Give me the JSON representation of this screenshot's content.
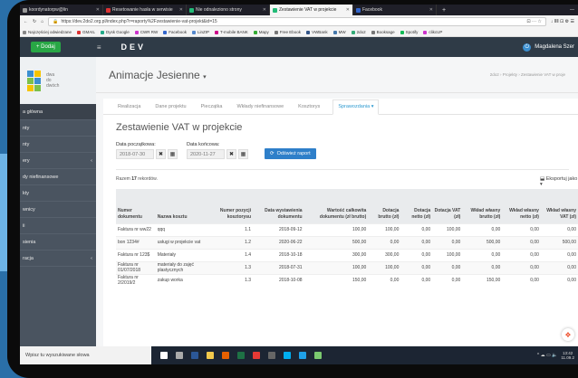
{
  "browser": {
    "tabs": [
      {
        "label": "koordynatorpw@lin",
        "color": "#999"
      },
      {
        "label": "Resetowanie hasła w serwisie",
        "color": "#d33"
      },
      {
        "label": "Nie odnaleziono strony",
        "color": "#2b7"
      },
      {
        "label": "Zestawienie VAT w projekcie",
        "color": "#2b7"
      },
      {
        "label": "Facebook",
        "color": "#36c"
      }
    ],
    "new_tab": "+",
    "window_controls": "—",
    "url": "https://dev.2do2.org.pl/index.php?r=raporty%2Fzestawienie-vat-projekt&id=15",
    "url_actions": "⊡ ··· ☆",
    "toolbar_right": "↓ ⅡⅡ ⊡ ⚙ ☰",
    "bookmarks": [
      {
        "label": "Najczęściej odwiedzane",
        "color": "#888"
      },
      {
        "label": "GMAIL",
        "color": "#d33"
      },
      {
        "label": "Dysk Google",
        "color": "#2a8"
      },
      {
        "label": "CWR RW",
        "color": "#c3c"
      },
      {
        "label": "Facebook",
        "color": "#36c"
      },
      {
        "label": "LinZIP",
        "color": "#58c"
      },
      {
        "label": "T-mobile BANK",
        "color": "#c08"
      },
      {
        "label": "Mapy",
        "color": "#3a3"
      },
      {
        "label": "Free Ebook",
        "color": "#777"
      },
      {
        "label": "VWBank",
        "color": "#358"
      },
      {
        "label": "MW",
        "color": "#47a"
      },
      {
        "label": "2do2",
        "color": "#3a7"
      },
      {
        "label": "Booksage",
        "color": "#777"
      },
      {
        "label": "Spotify",
        "color": "#1b5"
      },
      {
        "label": "clikcUP",
        "color": "#c3c"
      }
    ]
  },
  "topnav": {
    "add_label": "+ Dodaj",
    "menu_icon": "≡",
    "app_title": "DEV",
    "user_name": "Magdalena Szer",
    "power_icon": "⏻"
  },
  "sidebar": {
    "logo_text": [
      "dwa",
      "do",
      "dwóch"
    ],
    "items": [
      {
        "label": "a główna",
        "arrow": ""
      },
      {
        "label": "nty",
        "arrow": ""
      },
      {
        "label": "nty",
        "arrow": ""
      },
      {
        "label": "ery",
        "arrow": "‹"
      },
      {
        "label": "dy niefinansowe",
        "arrow": ""
      },
      {
        "label": "kty",
        "arrow": ""
      },
      {
        "label": "wnicy",
        "arrow": ""
      },
      {
        "label": "ii",
        "arrow": ""
      },
      {
        "label": "sienia",
        "arrow": ""
      },
      {
        "label": "racja",
        "arrow": "‹"
      }
    ]
  },
  "page": {
    "title": "Animacje Jesienne",
    "title_caret": "▾",
    "breadcrumb": "2do2 › Projekty › Zestawienie VAT w proje",
    "tabs": [
      "Realizacja",
      "Dane projektu",
      "Pieczątka",
      "Wkłady niefinansowe",
      "Kosztorys",
      "Sprawozdania ▾"
    ],
    "heading": "Zestawienie VAT w projekcie",
    "start_label": "Data początkowa:",
    "start_value": "2018-07-30",
    "end_label": "Data końcowa:",
    "end_value": "2020-11-27",
    "clear_icon": "✖",
    "calendar_icon": "▦",
    "refresh_icon": "⟳",
    "refresh_label": "Odśwież raport",
    "count_prefix": "Razem",
    "count": "17",
    "count_suffix": "rekordów.",
    "export_label": "Eksportuj jako ▾",
    "export_icon": "⬓"
  },
  "table": {
    "headers": [
      "Numer dokumentu",
      "Nazwa kosztu",
      "Numer pozycji kosztorysu",
      "Data wystawienia dokumentu",
      "Wartość całkowita dokumentu (zł brutto)",
      "Dotacja brutto (zł)",
      "Dotacja netto (zł)",
      "Dotacja VAT (zł)",
      "Wkład własny brutto (zł)",
      "Wkład własny netto (zł)",
      "Wkład własny VAT (zł)"
    ],
    "rows": [
      [
        "Faktura nr ww22",
        "qqq",
        "1.1",
        "2018-09-12",
        "100,00",
        "100,00",
        "0,00",
        "100,00",
        "0,00",
        "0,00",
        "0,00"
      ],
      [
        "bon 1234#",
        "usługi w projekcie vat",
        "1.2",
        "2020-06-22",
        "500,00",
        "0,00",
        "0,00",
        "0,00",
        "500,00",
        "0,00",
        "500,00"
      ],
      [
        "Faktura nr 123$",
        "Materiały",
        "1.4",
        "2018-10-18",
        "300,00",
        "300,00",
        "0,00",
        "100,00",
        "0,00",
        "0,00",
        "0,00"
      ],
      [
        "Faktura nr 01/07/2018",
        "materiały do zajęć plastycznych",
        "1.3",
        "2018-07-31",
        "100,00",
        "100,00",
        "0,00",
        "0,00",
        "0,00",
        "0,00",
        "0,00"
      ],
      [
        "Faktura nr 2/2019/2",
        "zakup worka",
        "1.3",
        "2018-10-08",
        "150,00",
        "0,00",
        "0,00",
        "0,00",
        "150,00",
        "0,00",
        "0,00"
      ]
    ]
  },
  "taskbar": {
    "search_placeholder": "Wpisz tu wyszukiwane słowa",
    "apps": [
      {
        "name": "windows-start",
        "color": "#fff"
      },
      {
        "name": "task-view",
        "color": "#aaa"
      },
      {
        "name": "word",
        "color": "#2b5797"
      },
      {
        "name": "file-explorer",
        "color": "#f2c94c"
      },
      {
        "name": "firefox",
        "color": "#e66000"
      },
      {
        "name": "excel",
        "color": "#1e7145"
      },
      {
        "name": "chrome",
        "color": "#e53935"
      },
      {
        "name": "calculator",
        "color": "#666"
      },
      {
        "name": "skype",
        "color": "#00aff0"
      },
      {
        "name": "edge",
        "color": "#1fa0e8"
      },
      {
        "name": "paint",
        "color": "#7bc96f"
      }
    ],
    "tray_icons": "^ ☁ ▭ 🔈",
    "time": "13:42",
    "date": "11.09.2"
  }
}
